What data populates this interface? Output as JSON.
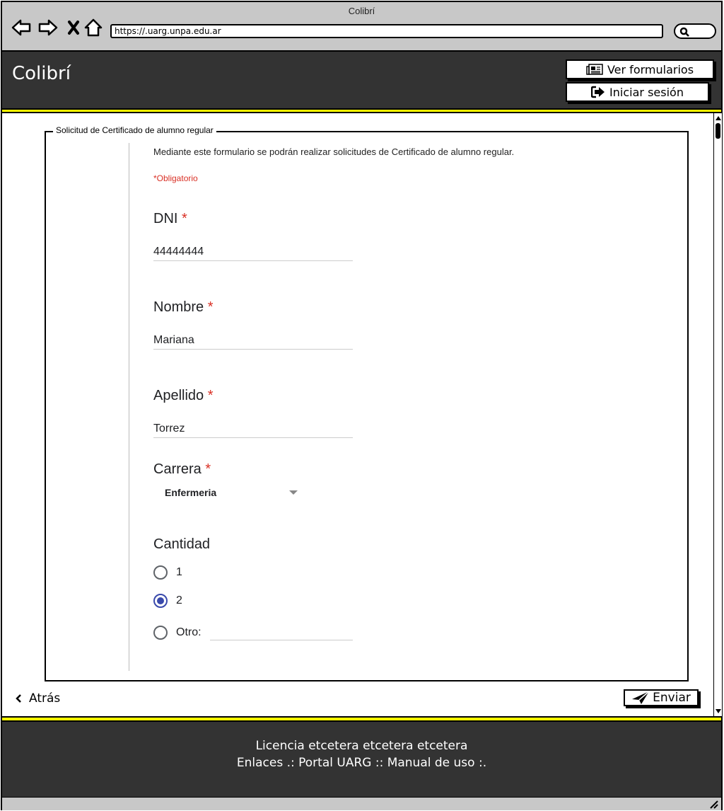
{
  "window": {
    "title": "Colibrí"
  },
  "browser": {
    "url": "https://.uarg.unpa.edu.ar"
  },
  "header": {
    "app_title": "Colibrí",
    "btn_forms": "Ver formularios",
    "btn_login": "Iniciar sesión"
  },
  "form": {
    "legend": "Solicitud de Certificado de alumno regular",
    "description": "Mediante este formulario se podrán realizar solicitudes de Certificado de alumno regular.",
    "required_note": "*Obligatorio",
    "required_star": "*",
    "dni": {
      "label": "DNI",
      "value": "44444444"
    },
    "nombre": {
      "label": "Nombre",
      "value": "Mariana"
    },
    "apellido": {
      "label": "Apellido",
      "value": "Torrez"
    },
    "carrera": {
      "label": "Carrera",
      "selected": "Enfermeria"
    },
    "cantidad": {
      "label": "Cantidad",
      "options": [
        "1",
        "2",
        "Otro:"
      ],
      "selected": "2"
    }
  },
  "actions": {
    "back": "Atrás",
    "send": "Enviar"
  },
  "footer": {
    "line1": "Licencia etcetera etcetera etcetera",
    "line2": "Enlaces .: Portal UARG :: Manual de uso :."
  },
  "colors": {
    "header_bg": "#333333",
    "accent_yellow": "#ffff00",
    "required_red": "#d93025",
    "radio_blue": "#3949ab"
  }
}
